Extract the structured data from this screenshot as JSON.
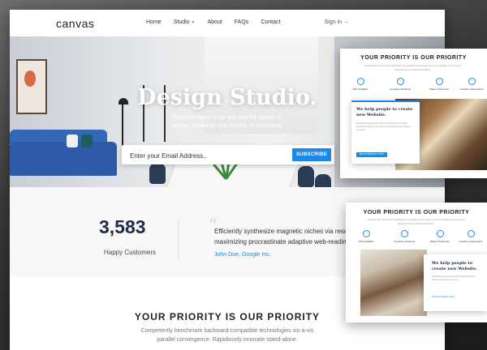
{
  "nav": {
    "logo": "canvas",
    "links": [
      "Home",
      "Studio",
      "About",
      "FAQs",
      "Contact"
    ],
    "signin": "Sign in →"
  },
  "hero": {
    "title": "Design Studio.",
    "subtitle": "Sell your home to us and skip the hassle of repairs, showings and months of uncertainty",
    "email_placeholder": "Enter your Email Address..",
    "subscribe_label": "SUBSCRIBE"
  },
  "stats": {
    "number": "3,583",
    "label": "Happy Customers",
    "quote": "Efficiently synthesize magnetic niches via resou maximizing procrastinate adaptive web-readine",
    "author": "John Doe, Google Inc."
  },
  "priority": {
    "title": "YOUR PRIORITY IS OUR PRIORITY",
    "description": "Competently benchmark backward-compatible technologies vis-a-vis parallel convergence. Rapidiously innovate stand-alone."
  },
  "card1": {
    "title": "YOUR PRIORITY IS OUR PRIORITY",
    "description": "Competently benchmark backward-compatible technologies vis-a-vis parallel convergence. Rapidiously innovate stand-alone.",
    "features": [
      "24/7 Available",
      "Complete Solutions",
      "Water Treatments",
      "Location Independent"
    ],
    "box_title": "We help people to create new Website.",
    "box_text": "Enthusiastically embrace efficient infrastructures through empowered services. Assertively administrate cross-platform scenarios.",
    "box_button": "READ COMPLETE STORY"
  },
  "card2": {
    "title": "YOUR PRIORITY IS OUR PRIORITY",
    "description": "Competently benchmark backward-compatible technologies vis-a-vis parallel convergence. Rapidiously innovate stand-alone.",
    "features": [
      "24/7 Available",
      "Complete Solutions",
      "Water Treatments",
      "Location Independent"
    ],
    "box_title": "We help people to create new Website.",
    "box_text": "Enthusiastically embrace efficient infrastructures through empowered services.",
    "box_link": "Read Complete Story"
  },
  "colors": {
    "accent": "#1e88e5",
    "dark_navy": "#222c44",
    "sofa_blue": "#2f5aa8"
  }
}
